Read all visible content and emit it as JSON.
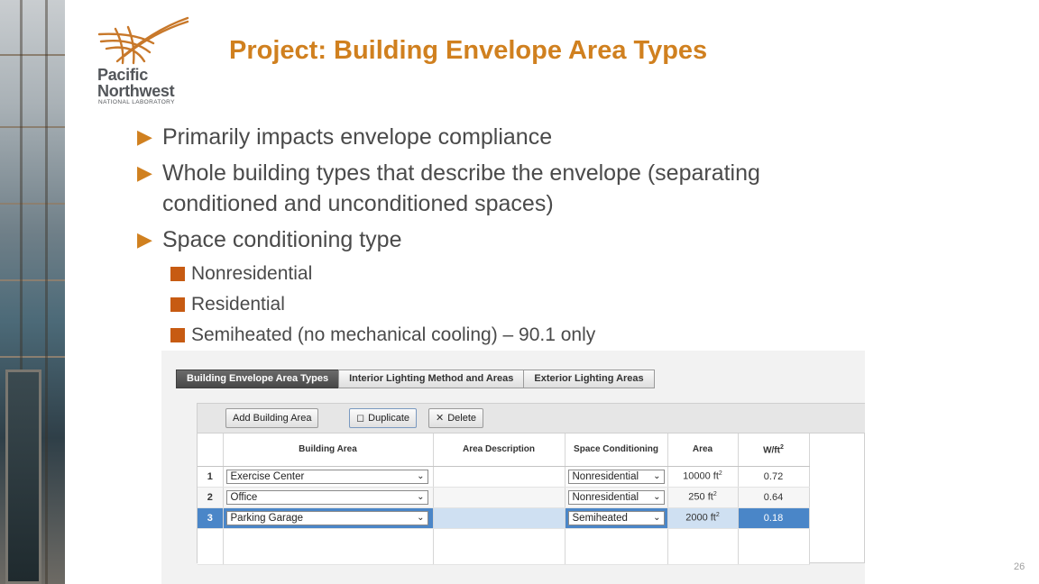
{
  "logo": {
    "line1": "Pacific",
    "line2": "Northwest",
    "line3": "NATIONAL LABORATORY"
  },
  "title": "Project: Building Envelope Area Types",
  "bullets": [
    "Primarily impacts envelope compliance",
    "Whole building types that describe the envelope (separating conditioned and unconditioned spaces)",
    "Space conditioning type"
  ],
  "sub_bullets": [
    "Nonresidential",
    "Residential",
    "Semiheated (no mechanical cooling) – 90.1 only"
  ],
  "app": {
    "tabs": [
      "Building Envelope Area Types",
      "Interior Lighting Method and Areas",
      "Exterior Lighting Areas"
    ],
    "active_tab": 0,
    "toolbar": {
      "add": "Add Building Area",
      "duplicate": "Duplicate",
      "delete": "Delete"
    },
    "columns": [
      "Building Area",
      "Area Description",
      "Space Conditioning",
      "Area",
      "W/ft"
    ],
    "wft_superscript": "2",
    "rows": [
      {
        "num": "1",
        "building_area": "Exercise Center",
        "description": "",
        "conditioning": "Nonresidential",
        "area": "10000 ft",
        "area_sup": "2",
        "wft": "0.72"
      },
      {
        "num": "2",
        "building_area": "Office",
        "description": "",
        "conditioning": "Nonresidential",
        "area": "250 ft",
        "area_sup": "2",
        "wft": "0.64"
      },
      {
        "num": "3",
        "building_area": "Parking Garage",
        "description": "",
        "conditioning": "Semiheated",
        "area": "2000 ft",
        "area_sup": "2",
        "wft": "0.18"
      }
    ],
    "selected_row": 2
  },
  "page_number": "26",
  "colors": {
    "accent": "#d0801f",
    "bullet_square": "#c75b12",
    "selected_row": "#4a86c8"
  }
}
